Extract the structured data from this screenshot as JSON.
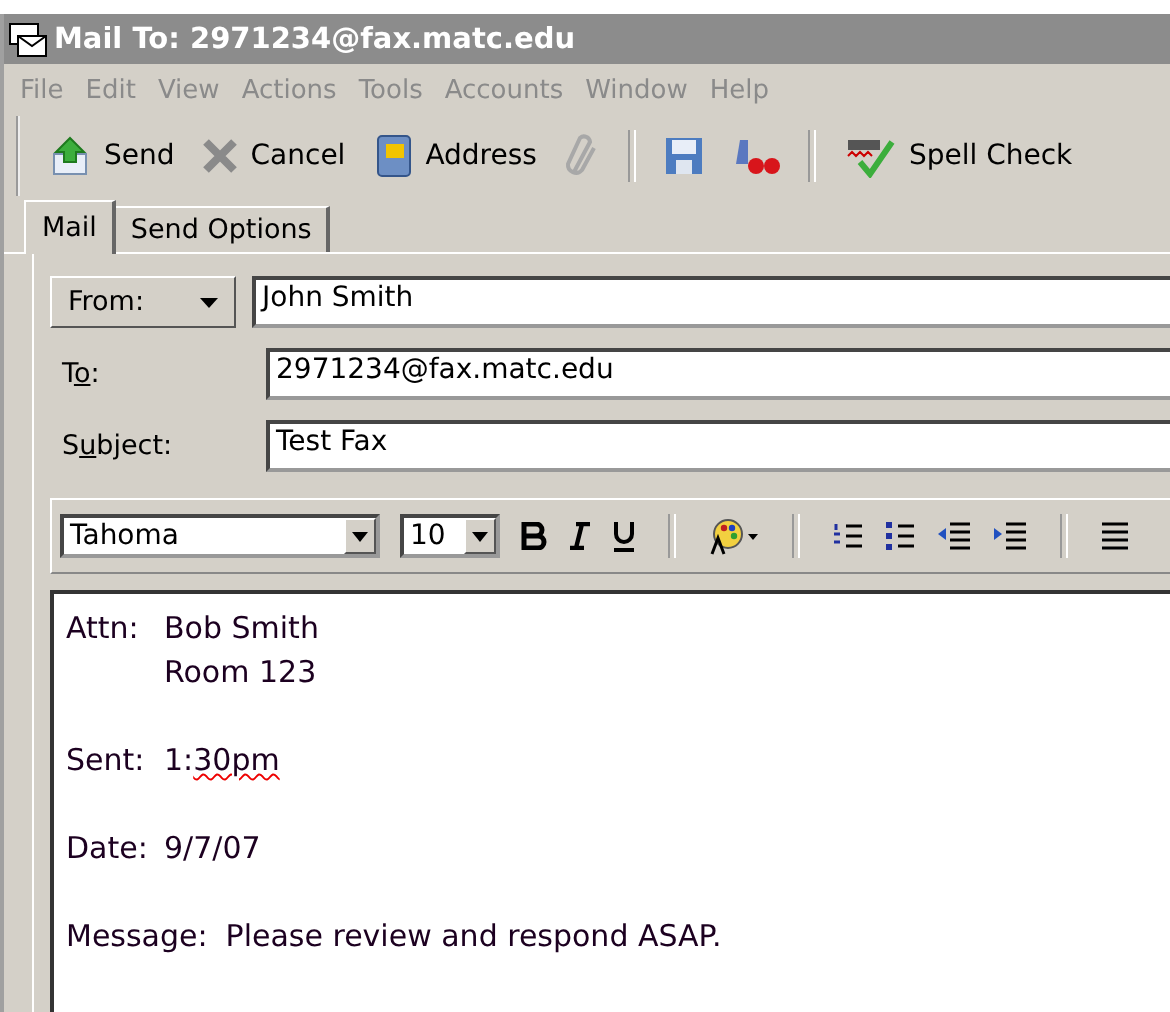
{
  "window": {
    "title": "Mail To: 2971234@fax.matc.edu"
  },
  "menu": [
    "File",
    "Edit",
    "View",
    "Actions",
    "Tools",
    "Accounts",
    "Window",
    "Help"
  ],
  "toolbar": [
    {
      "kind": "send",
      "label": "Send"
    },
    {
      "kind": "cancel",
      "label": "Cancel"
    },
    {
      "kind": "address",
      "label": "Address"
    },
    {
      "kind": "attach"
    },
    {
      "kind": "separator"
    },
    {
      "kind": "save"
    },
    {
      "kind": "priority"
    },
    {
      "kind": "separator"
    },
    {
      "kind": "spell",
      "label": "Spell Check"
    }
  ],
  "tabs": [
    {
      "label": "Mail",
      "selected": true
    },
    {
      "label": "Send Options",
      "selected": false
    }
  ],
  "fields": [
    {
      "kind": "dropdown",
      "label": "From:",
      "value": "John Smith"
    },
    {
      "kind": "plain",
      "label_parts": [
        {
          "text": "T",
          "underlined": false
        },
        {
          "text": "o",
          "underlined": true
        },
        {
          "text": ":",
          "underlined": false
        }
      ],
      "value": "2971234@fax.matc.edu"
    },
    {
      "kind": "plain",
      "label_parts": [
        {
          "text": "S",
          "underlined": false
        },
        {
          "text": "u",
          "underlined": true
        },
        {
          "text": "bject:",
          "underlined": false
        }
      ],
      "value": "Test Fax"
    }
  ],
  "format_bar": {
    "font": "Tahoma",
    "size": "10",
    "tools": [
      {
        "kind": "bold"
      },
      {
        "kind": "italic"
      },
      {
        "kind": "underline"
      },
      {
        "kind": "sep"
      },
      {
        "kind": "color"
      },
      {
        "kind": "sep"
      },
      {
        "kind": "numbered"
      },
      {
        "kind": "bulleted"
      },
      {
        "kind": "outdent"
      },
      {
        "kind": "indent"
      },
      {
        "kind": "sep"
      },
      {
        "kind": "align"
      }
    ]
  },
  "body": [
    {
      "label": "Attn:",
      "parts": [
        {
          "text": "Bob Smith",
          "misspelled": false
        }
      ]
    },
    {
      "parts": [
        {
          "text": "Room 123",
          "misspelled": false
        }
      ]
    },
    {
      "kind": "blank"
    },
    {
      "label": "Sent:",
      "parts": [
        {
          "text": "1:",
          "misspelled": false
        },
        {
          "text": "30pm",
          "misspelled": true
        }
      ]
    },
    {
      "kind": "blank"
    },
    {
      "label": "Date:",
      "parts": [
        {
          "text": "9/7/07",
          "misspelled": false
        }
      ]
    },
    {
      "kind": "blank"
    },
    {
      "label": "Message:",
      "parts": [
        {
          "text": "Please review and respond ASAP.",
          "misspelled": false
        }
      ]
    }
  ]
}
